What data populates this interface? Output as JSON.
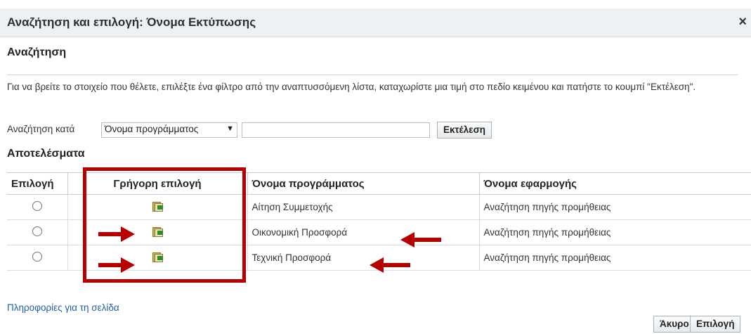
{
  "dialog": {
    "title": "Αναζήτηση και επιλογή: Όνομα Εκτύπωσης",
    "close_label": "×"
  },
  "search": {
    "heading": "Αναζήτηση",
    "help_text": "Για να βρείτε το στοιχείο που θέλετε, επιλέξτε ένα φίλτρο από την αναπτυσσόμενη λίστα, καταχωρίστε μια τιμή στο πεδίο κειμένου και πατήστε το κουμπί \"Εκτέλεση\".",
    "search_by_label": "Αναζήτηση κατά",
    "filter_selected": "Όνομα προγράμματος",
    "text_value": "",
    "go_button": "Εκτέλεση"
  },
  "results": {
    "heading": "Αποτελέσματα",
    "columns": [
      "Επιλογή",
      "Γρήγορη επιλογή",
      "Όνομα προγράμματος",
      "Όνομα εφαρμογής"
    ],
    "rows": [
      {
        "program": "Αίτηση Συμμετοχής",
        "application": "Αναζήτηση πηγής προμήθειας"
      },
      {
        "program": "Οικονομική Προσφορά",
        "application": "Αναζήτηση πηγής προμήθειας"
      },
      {
        "program": "Τεχνική Προσφορά",
        "application": "Αναζήτηση πηγής προμήθειας"
      }
    ]
  },
  "footer": {
    "page_info_link": "Πληροφορίες για τη σελίδα",
    "cancel_button": "Άκυρο",
    "select_button": "Επιλογή"
  },
  "colors": {
    "annotation_red": "#b60000",
    "link_blue": "#1f5fa8"
  }
}
